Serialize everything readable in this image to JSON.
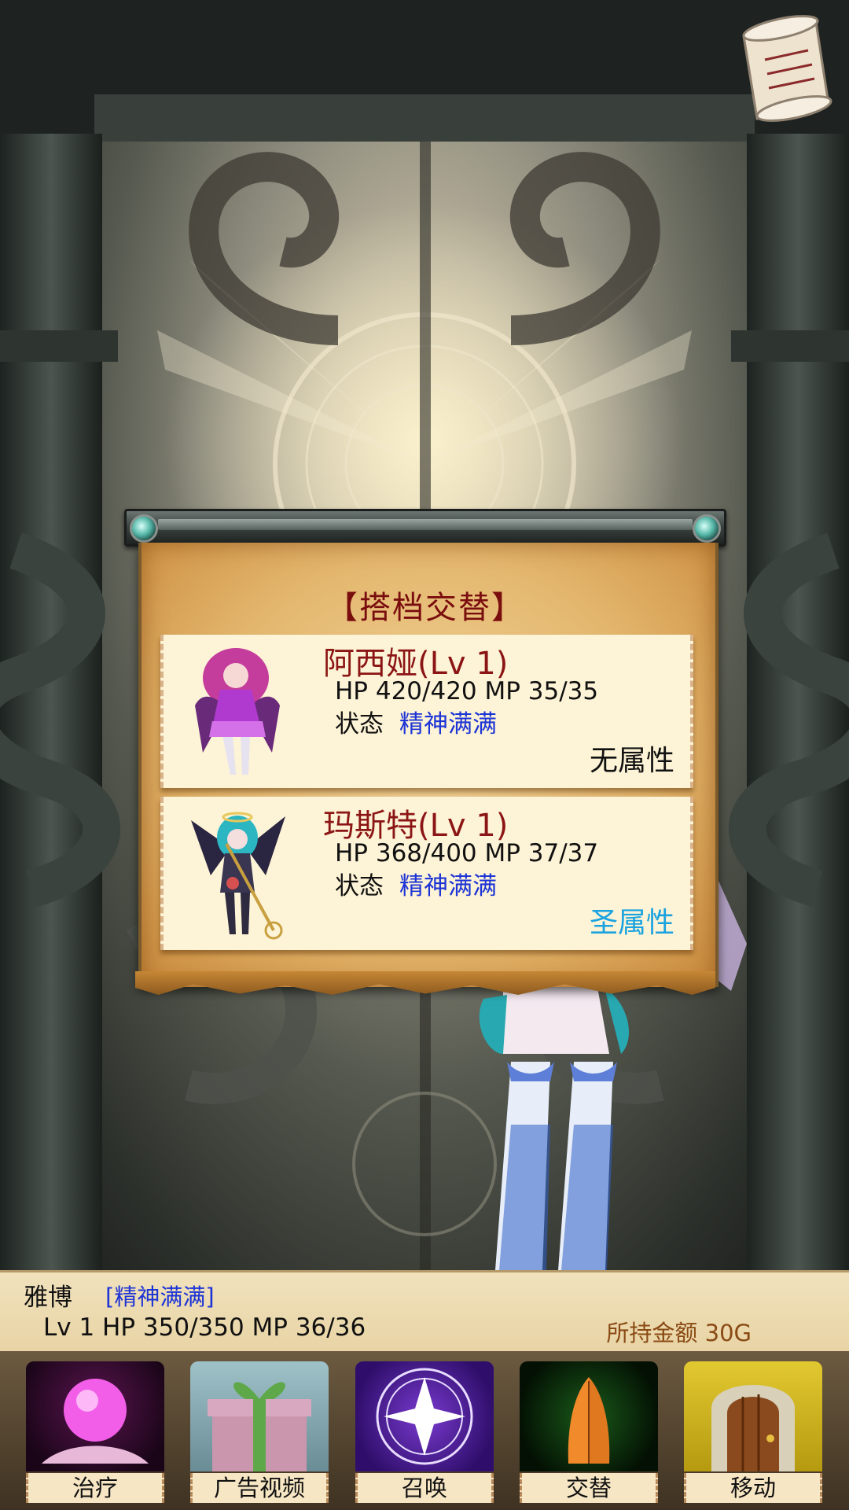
{
  "dialog": {
    "title": "【搭档交替】",
    "partners": [
      {
        "name": "阿西娅",
        "level": "(Lv 1)",
        "stats": "HP 420/420   MP 35/35",
        "status_label": "状态",
        "status_value": "精神满满",
        "attribute": "无属性",
        "attribute_color": "#111111"
      },
      {
        "name": "玛斯特",
        "level": "(Lv 1)",
        "stats": "HP 368/400   MP 37/37",
        "status_label": "状态",
        "status_value": "精神满满",
        "attribute": "圣属性",
        "attribute_color": "#1aa3e0"
      }
    ]
  },
  "player": {
    "name": "雅博",
    "state": "[精神满满]",
    "stats": "Lv 1  HP 350/350  MP 36/36",
    "gold": "所持金额 30G"
  },
  "actions": [
    {
      "label": "治疗",
      "icon": "crystal-ball-icon"
    },
    {
      "label": "广告视频",
      "icon": "gift-box-icon"
    },
    {
      "label": "召唤",
      "icon": "magic-circle-icon"
    },
    {
      "label": "交替",
      "icon": "praying-hands-icon"
    },
    {
      "label": "移动",
      "icon": "door-icon"
    }
  ],
  "colors": {
    "title_red": "#7a0d0d",
    "name_red": "#8b1515",
    "status_blue": "#1d34d6",
    "holy_cyan": "#1aa3e0",
    "gold_brown": "#8a4a14"
  }
}
